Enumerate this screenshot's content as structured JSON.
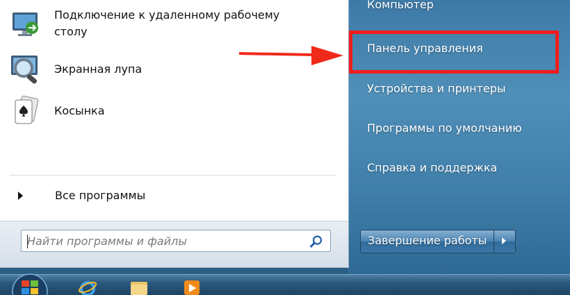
{
  "left_pane": {
    "programs": [
      {
        "label_line1": "Подключение к удаленному рабочему",
        "label_line2": "столу",
        "icon": "remote-desktop-icon"
      },
      {
        "label_line1": "Экранная лупа",
        "label_line2": "",
        "icon": "magnifier-icon"
      },
      {
        "label_line1": "Косынка",
        "label_line2": "",
        "icon": "solitaire-icon"
      }
    ],
    "all_programs": "Все программы",
    "search": {
      "placeholder": "Найти программы и файлы",
      "value": "",
      "icon": "search-icon"
    }
  },
  "right_pane": {
    "items": [
      {
        "label": "Компьютер"
      },
      {
        "label": "Панель управления",
        "highlighted": true
      },
      {
        "label": "Устройства и принтеры"
      },
      {
        "label": "Программы по умолчанию"
      },
      {
        "label": "Справка и поддержка"
      }
    ],
    "shutdown": {
      "label": "Завершение работы",
      "arrow_icon": "chevron-right-icon"
    }
  },
  "annotation": {
    "highlight_color": "#f01d1d",
    "arrow_color": "#f02a1a"
  },
  "taskbar": {
    "icons": [
      "start-orb-icon",
      "internet-explorer-icon",
      "folder-icon",
      "media-player-icon"
    ]
  }
}
